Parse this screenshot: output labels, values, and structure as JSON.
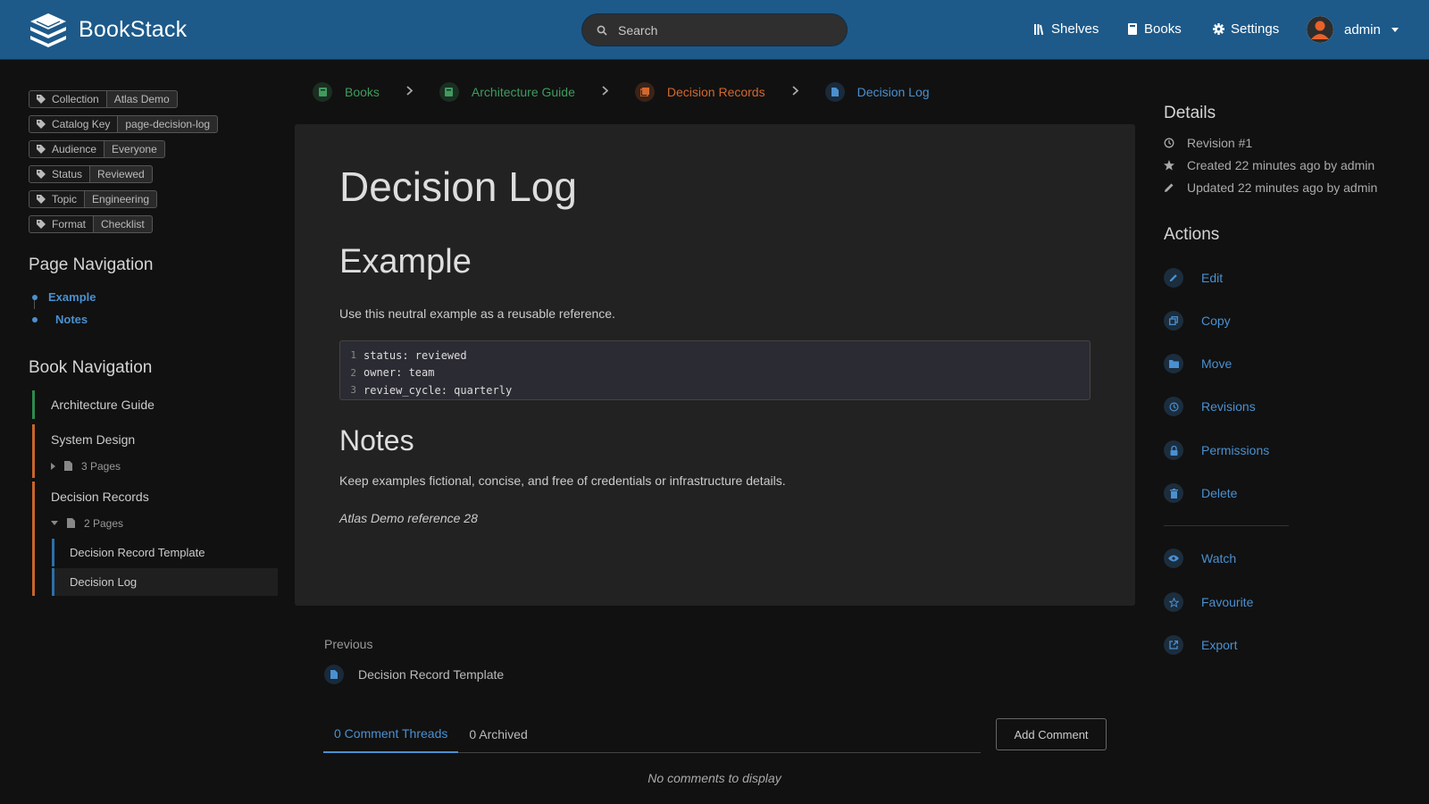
{
  "header": {
    "app_name": "BookStack",
    "search_placeholder": "Search",
    "nav": {
      "shelves": "Shelves",
      "books": "Books",
      "settings": "Settings"
    },
    "user_name": "admin"
  },
  "tags": [
    {
      "name": "Collection",
      "value": "Atlas Demo"
    },
    {
      "name": "Catalog Key",
      "value": "page-decision-log"
    },
    {
      "name": "Audience",
      "value": "Everyone"
    },
    {
      "name": "Status",
      "value": "Reviewed"
    },
    {
      "name": "Topic",
      "value": "Engineering"
    },
    {
      "name": "Format",
      "value": "Checklist"
    }
  ],
  "page_navigation": {
    "title": "Page Navigation",
    "items": [
      "Example",
      "Notes"
    ]
  },
  "book_navigation": {
    "title": "Book Navigation",
    "book": "Architecture Guide",
    "chapters": [
      {
        "title": "System Design",
        "pages_label": "3 Pages"
      },
      {
        "title": "Decision Records",
        "pages_label": "2 Pages",
        "pages": [
          "Decision Record Template",
          "Decision Log"
        ]
      }
    ]
  },
  "breadcrumb": [
    "Books",
    "Architecture Guide",
    "Decision Records",
    "Decision Log"
  ],
  "page": {
    "title": "Decision Log",
    "section1_heading": "Example",
    "section1_text": "Use this neutral example as a reusable reference.",
    "code": [
      {
        "n": "1",
        "text": "status: reviewed"
      },
      {
        "n": "2",
        "text": "owner: team"
      },
      {
        "n": "3",
        "text": "review_cycle: quarterly"
      }
    ],
    "section2_heading": "Notes",
    "section2_text": "Keep examples fictional, concise, and free of credentials or infrastructure details.",
    "reference": "Atlas Demo reference 28"
  },
  "previous": {
    "label": "Previous",
    "title": "Decision Record Template"
  },
  "comments": {
    "tab_threads": "0 Comment Threads",
    "tab_archived": "0 Archived",
    "add_button": "Add Comment",
    "empty": "No comments to display"
  },
  "details": {
    "title": "Details",
    "revision": "Revision #1",
    "created": "Created 22 minutes ago by admin",
    "updated": "Updated 22 minutes ago by admin"
  },
  "actions": {
    "title": "Actions",
    "edit": "Edit",
    "copy": "Copy",
    "move": "Move",
    "revisions": "Revisions",
    "permissions": "Permissions",
    "delete": "Delete",
    "watch": "Watch",
    "favourite": "Favourite",
    "export": "Export"
  },
  "colors": {
    "header": "#1d5a8a",
    "link": "#4a90d0",
    "book": "#2e8a4e",
    "chapter": "#c7652c",
    "page": "#2d6fa8"
  }
}
